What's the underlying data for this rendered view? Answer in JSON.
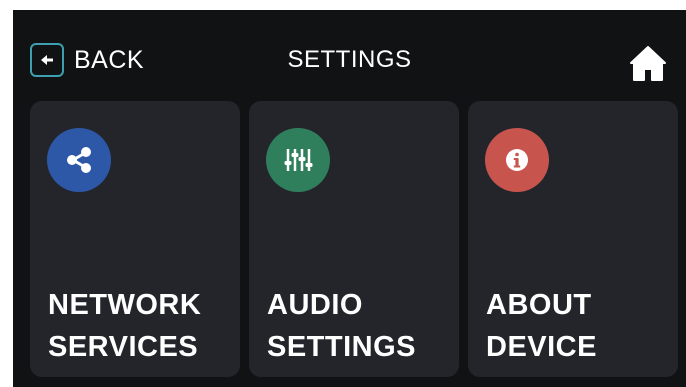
{
  "header": {
    "back_label": "BACK",
    "title": "SETTINGS",
    "back_icon": "arrow-left-icon",
    "home_icon": "home-icon"
  },
  "cards": [
    {
      "line1": "NETWORK",
      "line2": "SERVICES",
      "icon": "share-icon",
      "icon_color": "#2d58a7"
    },
    {
      "line1": "AUDIO",
      "line2": "SETTINGS",
      "icon": "sliders-icon",
      "icon_color": "#2f7f5c"
    },
    {
      "line1": "ABOUT",
      "line2": "DEVICE",
      "icon": "info-icon",
      "icon_color": "#c8544e"
    }
  ],
  "colors": {
    "background": "#111214",
    "card": "#23252b",
    "accent": "#3d9fb0",
    "text": "#ffffff"
  }
}
